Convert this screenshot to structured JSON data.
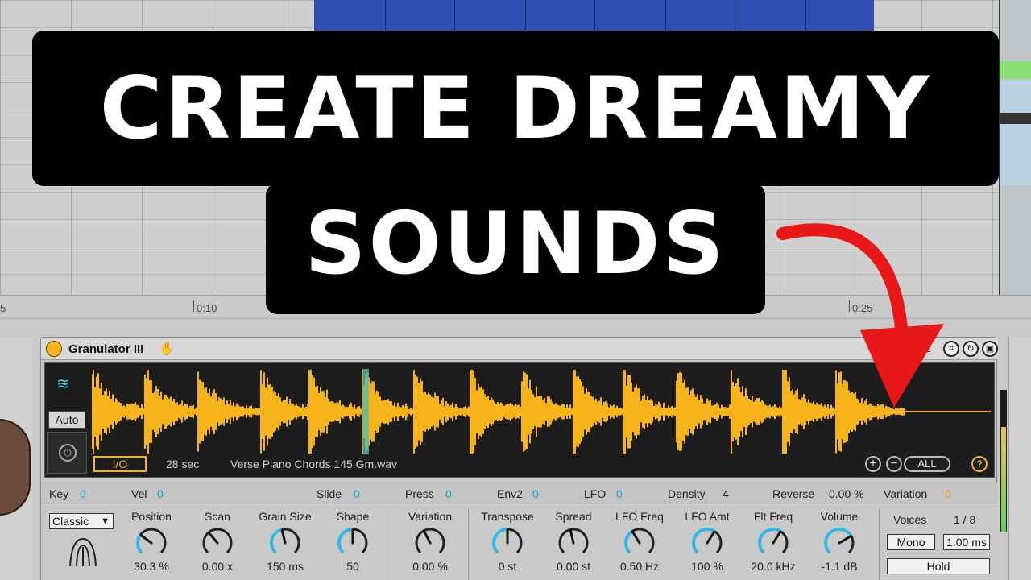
{
  "thumbnail": {
    "title_line_1": "CREATE DREAMY",
    "title_line_2": "SOUNDS"
  },
  "timeline": {
    "markers": [
      "5",
      "0:10",
      "0:25"
    ]
  },
  "device": {
    "name": "Granulator III",
    "header_letter": "E",
    "auto_label": "Auto",
    "io_label": "I/O",
    "sample_length": "28 sec",
    "sample_name": "Verse Piano Chords 145 Gm.wav",
    "zoom_in_label": "+",
    "zoom_out_label": "−",
    "all_label": "ALL",
    "help_label": "?",
    "waveform_color": "#f6b31a",
    "grain_marker_color": "#5bb8a8",
    "modulation": [
      {
        "label": "Key",
        "value": "0"
      },
      {
        "label": "Vel",
        "value": "0"
      },
      {
        "label": "Slide",
        "value": "0"
      },
      {
        "label": "Press",
        "value": "0"
      },
      {
        "label": "Env2",
        "value": "0"
      },
      {
        "label": "LFO",
        "value": "0"
      },
      {
        "label": "Density",
        "value": "4"
      },
      {
        "label": "Reverse",
        "value": "0.00 %"
      },
      {
        "label": "Variation",
        "value": "0"
      }
    ],
    "mode_select": "Classic",
    "knobs": [
      {
        "label": "Position",
        "value": "30.3 %",
        "active": true,
        "level": 0.3
      },
      {
        "label": "Scan",
        "value": "0.00 x",
        "active": false,
        "level": 0.35
      },
      {
        "label": "Grain Size",
        "value": "150 ms",
        "active": true,
        "level": 0.45
      },
      {
        "label": "Shape",
        "value": "50",
        "active": true,
        "level": 0.5
      },
      {
        "label": "Variation",
        "value": "0.00 %",
        "active": false,
        "level": 0.4
      },
      {
        "label": "Transpose",
        "value": "0 st",
        "active": true,
        "level": 0.5
      },
      {
        "label": "Spread",
        "value": "0.00 st",
        "active": false,
        "level": 0.45
      },
      {
        "label": "LFO Freq",
        "value": "0.50 Hz",
        "active": true,
        "level": 0.38
      },
      {
        "label": "LFO Amt",
        "value": "100 %",
        "active": true,
        "level": 0.62
      },
      {
        "label": "Flt Freq",
        "value": "20.0 kHz",
        "active": true,
        "level": 0.62
      },
      {
        "label": "Volume",
        "value": "-1.1 dB",
        "active": true,
        "level": 0.72
      }
    ],
    "voices_label": "Voices",
    "voices_value": "1 / 8",
    "mono_label": "Mono",
    "glide_value": "1.00 ms",
    "hold_label": "Hold",
    "accent_color": "#35b7e6"
  }
}
